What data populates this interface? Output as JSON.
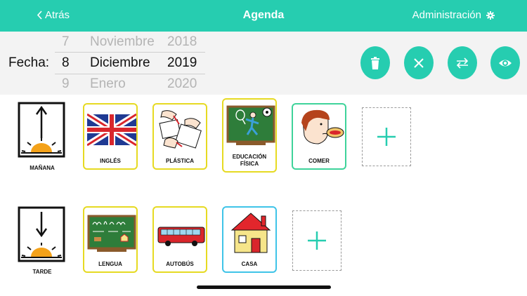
{
  "header": {
    "back_label": "Atrás",
    "title": "Agenda",
    "admin_label": "Administración"
  },
  "date": {
    "label": "Fecha:",
    "prev": {
      "day": "7",
      "month": "Noviembre",
      "year": "2018"
    },
    "current": {
      "day": "8",
      "month": "Diciembre",
      "year": "2019"
    },
    "next": {
      "day": "9",
      "month": "Enero",
      "year": "2020"
    }
  },
  "actions": [
    {
      "name": "delete",
      "icon": "trash-icon"
    },
    {
      "name": "clear",
      "icon": "close-icon"
    },
    {
      "name": "swap",
      "icon": "swap-arrows-icon"
    },
    {
      "name": "preview",
      "icon": "eye-icon"
    }
  ],
  "morning": {
    "label": "MAÑANA",
    "items": [
      "INGLÉS",
      "PLÁSTICA",
      "EDUCACIÓN FÍSICA",
      "COMER"
    ]
  },
  "afternoon": {
    "label": "TARDE",
    "items": [
      "LENGUA",
      "AUTOBÚS",
      "CASA"
    ]
  },
  "colors": {
    "accent": "#26cdb0",
    "card_yellow": "#e6da22",
    "card_green": "#3ed39a",
    "card_blue": "#3fc4e8"
  }
}
